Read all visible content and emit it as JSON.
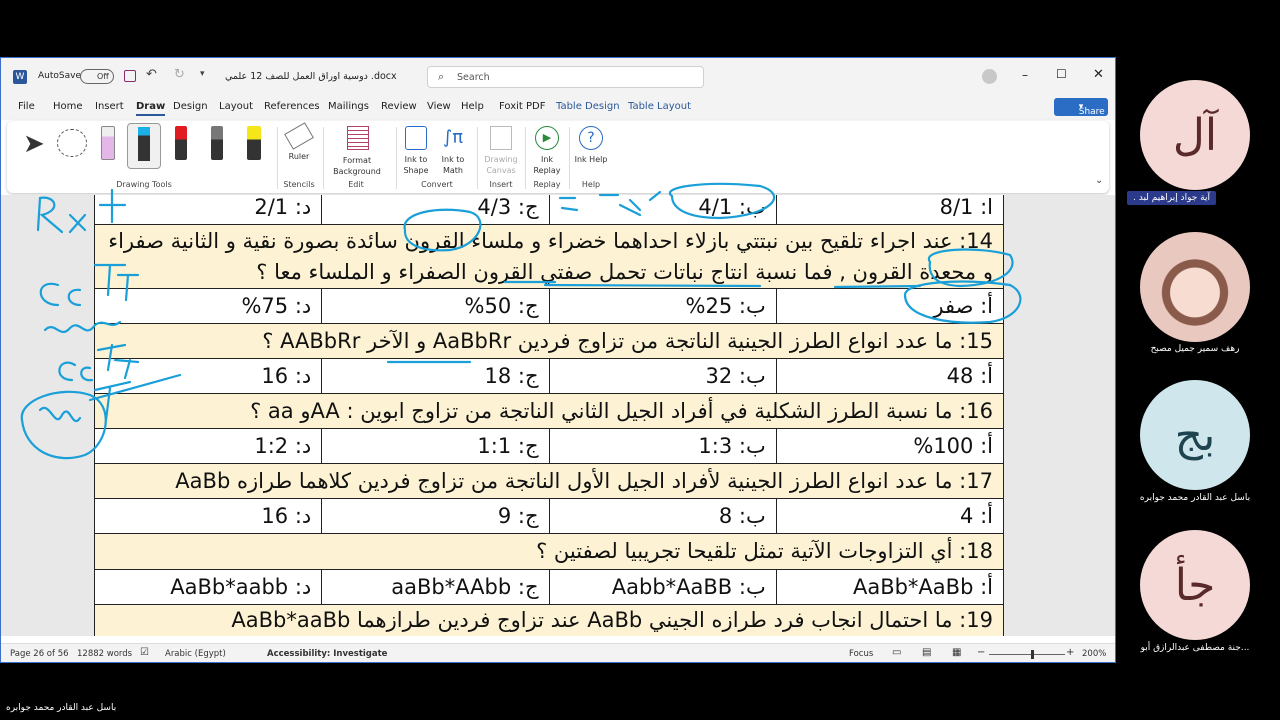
{
  "window": {
    "autosave": "AutoSave",
    "autosave_state": "Off",
    "doc_title": "دوسية اوراق العمل للصف 12 علمي .docx",
    "search_placeholder": "Search",
    "share": "Share"
  },
  "tabs": [
    "File",
    "Home",
    "Insert",
    "Draw",
    "Design",
    "Layout",
    "References",
    "Mailings",
    "Review",
    "View",
    "Help",
    "Foxit PDF",
    "Table Design",
    "Table Layout"
  ],
  "ribbon": {
    "drawing_tools": "Drawing Tools",
    "ruler": "Ruler",
    "stencils": "Stencils",
    "format_bg": "Format Background",
    "edit": "Edit",
    "ink_shape": "Ink to Shape",
    "ink_math": "Ink to Math",
    "convert": "Convert",
    "drawing_canvas": "Drawing Canvas",
    "insert": "Insert",
    "ink_replay": "Ink Replay",
    "replay": "Replay",
    "ink_help": "Ink Help",
    "help": "Help"
  },
  "rows": [
    {
      "kind": "a",
      "cells": [
        "ا: 8/1",
        "ب: 4/1",
        "ج: 4/3",
        "د: 2/1"
      ]
    },
    {
      "kind": "q",
      "text": "14: عند اجراء تلقيح بين نبتتي بازلاء احداهما خضراء و ملساء القرون سائدة بصورة نقية و الثانية صفراء و مجعدة القرون , فما نسبة انتاج نباتات تحمل صفتي القرون الصفراء و الملساء معا ؟"
    },
    {
      "kind": "a",
      "cells": [
        "أ: صفر",
        "ب: 25%",
        "ج: 50%",
        "د: 75%"
      ]
    },
    {
      "kind": "q",
      "text": "15: ما عدد انواع الطرز الجينية الناتجة من تزاوج فردين AaBbRr و الآخر AABbRr ؟"
    },
    {
      "kind": "a",
      "cells": [
        "أ: 48",
        "ب: 32",
        "ج: 18",
        "د: 16"
      ]
    },
    {
      "kind": "q",
      "text": "16: ما نسبة الطرز الشكلية في أفراد الجيل الثاني الناتجة من تزاوج ابوين : AAو aa ؟"
    },
    {
      "kind": "a",
      "cells": [
        "أ: 100%",
        "ب: 1:3",
        "ج: 1:1",
        "د: 1:2"
      ]
    },
    {
      "kind": "q",
      "text": "17: ما عدد انواع الطرز الجينية لأفراد الجيل الأول الناتجة من تزاوج فردين كلاهما طرازه AaBb"
    },
    {
      "kind": "a",
      "cells": [
        "أ: 4",
        "ب: 8",
        "ج: 9",
        "د: 16"
      ]
    },
    {
      "kind": "q",
      "text": "18: أي التزاوجات الآتية تمثل تلقيحا تجريبيا لصفتين ؟"
    },
    {
      "kind": "a",
      "cells": [
        "أ: AaBb*AaBb",
        "ب: Aabb*AaBB",
        "ج: aaBb*AAbb",
        "د: AaBb*aabb"
      ]
    },
    {
      "kind": "q",
      "text": "19: ما احتمال انجاب فرد طرازه الجيني AaBb عند تزاوج فردين طرازهما AaBb*aaBb"
    }
  ],
  "status": {
    "page": "Page 26 of 56",
    "words": "12882 words",
    "lang": "Arabic (Egypt)",
    "access": "Accessibility: Investigate",
    "focus": "Focus",
    "zoom": "200%"
  },
  "participants": [
    {
      "initials": "آل",
      "name": ". آية جواد إبراهيم لبد",
      "color": "#f4d9d6"
    },
    {
      "initials": "",
      "name": "رهف سمير جميل مصبح",
      "color": "#e9c8c0"
    },
    {
      "initials": "بج",
      "name": "باسل عبد القادر محمد جوابره",
      "color": "#cfe6ec"
    },
    {
      "initials": "جأ",
      "name": "جنة مصطفى عبدالرازق أبو...",
      "color": "#f4d9d6"
    }
  ],
  "speaker": "باسل عبد القادر محمد جوابره",
  "ink_notes": [
    "Rr",
    "CcTT",
    "ff"
  ]
}
